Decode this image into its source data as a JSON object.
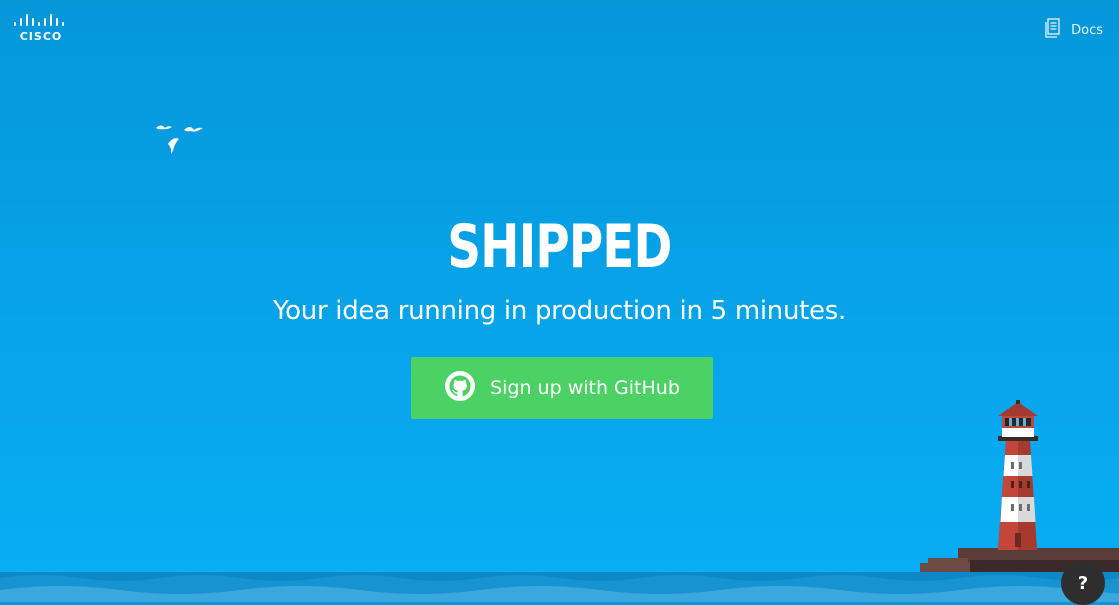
{
  "header": {
    "logo_text": "CISCO",
    "docs_label": "Docs",
    "docs_icon": "document-icon"
  },
  "hero": {
    "title": "SHIPPED",
    "tagline": "Your idea running in production in 5 minutes.",
    "signup_label": "Sign up with GitHub",
    "signup_icon": "github-icon"
  },
  "help": {
    "label": "?"
  },
  "colors": {
    "sky_top": "#0596d8",
    "sky_bottom": "#09aef4",
    "button": "#4cd264",
    "help_bg": "#2e2e2e"
  }
}
